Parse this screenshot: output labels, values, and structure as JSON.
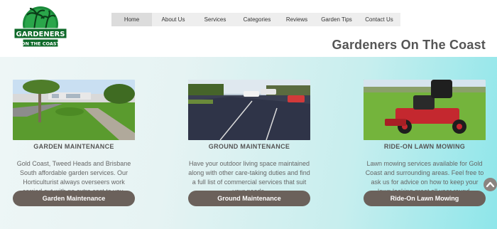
{
  "logo": {
    "line1": "GARDENERS",
    "line2": "ON THE COAST",
    "color": "#1a8a3a"
  },
  "nav": {
    "items": [
      "Home",
      "About Us",
      "Services",
      "Categories",
      "Reviews",
      "Garden Tips",
      "Contact Us"
    ],
    "active": "Home"
  },
  "site_title": "Gardeners On The Coast",
  "services": [
    {
      "title": "GARDEN MAINTENANCE",
      "text": "Gold Coast, Tweed Heads and Brisbane South affordable garden services. Our Horticulturist always overseers work carried out with no extra cost to you.",
      "button": "Garden Maintenance"
    },
    {
      "title": "GROUND MAINTENANCE",
      "text": "Have your outdoor living space maintained along with other care-taking duties and find a full list of commercial services that suit your needs.",
      "button": "Ground Maintenance"
    },
    {
      "title": "RIDE-ON LAWN MOWING",
      "text": "Lawn mowing services available for Gold Coast and surrounding areas. Feel free to ask us for advice on how to keep your lawn looking great all year round.",
      "button": "Ride-On Lawn Mowing"
    }
  ],
  "icons": {
    "scroll_top": "chevron-up-icon"
  },
  "colors": {
    "button": "#6b615b",
    "accent": "#8ee6ea",
    "title": "#555555"
  }
}
